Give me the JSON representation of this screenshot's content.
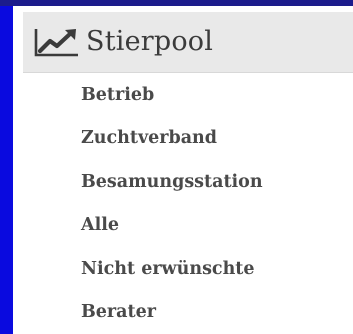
{
  "header": {
    "icon": "trending-up-chart-icon",
    "title": "Stierpool"
  },
  "menu": {
    "items": [
      {
        "label": "Betrieb"
      },
      {
        "label": "Zuchtverband"
      },
      {
        "label": "Besamungsstation"
      },
      {
        "label": "Alle"
      },
      {
        "label": "Nicht erwünschte"
      },
      {
        "label": "Berater"
      }
    ]
  },
  "colors": {
    "accent_bar": "#0a0adf",
    "header_bg": "#e9e9e9",
    "text": "#4a4a4a"
  }
}
